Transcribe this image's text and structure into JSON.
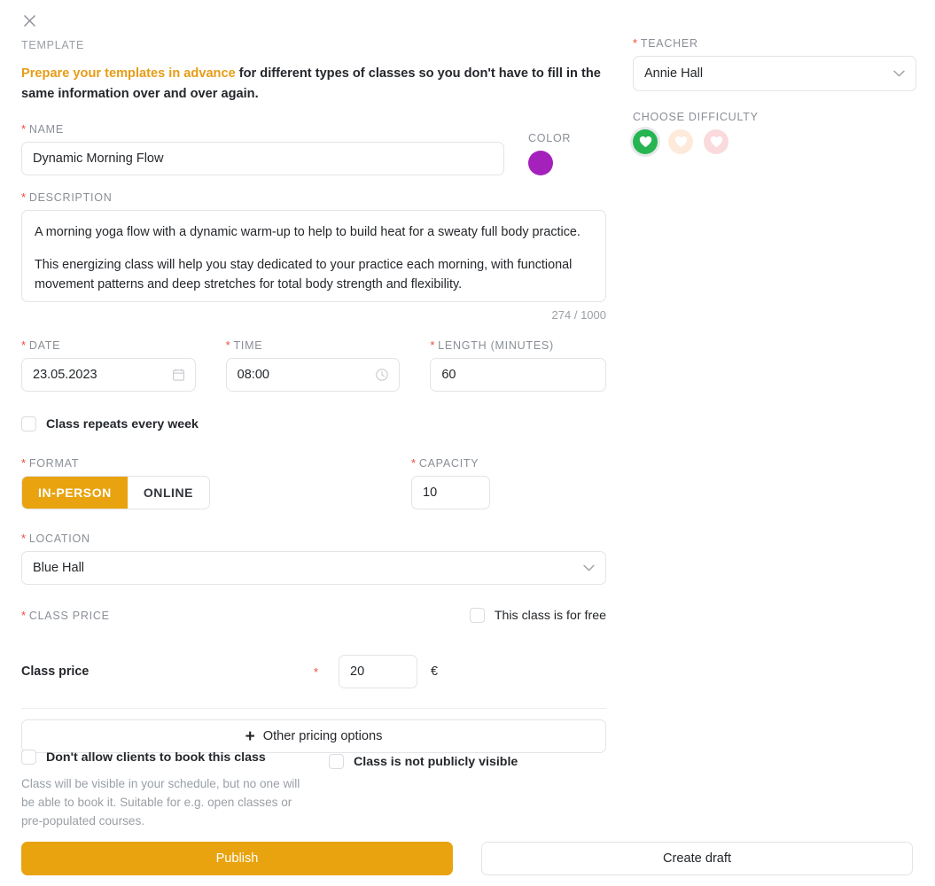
{
  "window": {
    "close_icon": "close-icon"
  },
  "template": {
    "section_label": "TEMPLATE",
    "intro_highlight": "Prepare your templates in advance",
    "intro_rest": " for different types of classes so you don't have to fill in the same information over and over again."
  },
  "name": {
    "label": "NAME",
    "value": "Dynamic Morning Flow"
  },
  "color": {
    "label": "COLOR",
    "value": "#a521bb"
  },
  "description": {
    "label": "DESCRIPTION",
    "paragraph1": "A morning yoga flow with a dynamic warm-up to help to build heat for a sweaty full body practice.",
    "paragraph2": "This energizing class will help you stay dedicated to your practice each morning, with functional movement patterns and deep stretches for total body strength and flexibility.",
    "counter": "274 / 1000"
  },
  "date": {
    "label": "DATE",
    "value": "23.05.2023",
    "icon": "calendar-icon"
  },
  "time": {
    "label": "TIME",
    "value": "08:00",
    "icon": "clock-icon"
  },
  "length": {
    "label": "LENGTH (MINUTES)",
    "value": "60"
  },
  "repeat": {
    "label": "Class repeats every week",
    "checked": false
  },
  "format": {
    "label": "FORMAT",
    "options": [
      "IN-PERSON",
      "ONLINE"
    ],
    "selected": "IN-PERSON"
  },
  "capacity": {
    "label": "CAPACITY",
    "value": "10"
  },
  "location": {
    "label": "LOCATION",
    "value": "Blue Hall",
    "icon": "chevron-down-icon"
  },
  "price": {
    "label": "CLASS PRICE",
    "free_label": "This class is for free",
    "free_checked": false,
    "row_name": "Class price",
    "row_required": "*",
    "value": "20",
    "currency": "€",
    "other_options": "Other pricing options",
    "plus_icon": "+"
  },
  "booking": {
    "no_book_label": "Don't allow clients to book this class",
    "no_book_checked": false,
    "help_text": "Class will be visible in your schedule, but no one will be able to book it. Suitable for e.g. open classes or pre-populated courses.",
    "not_public_label": "Class is not publicly visible",
    "not_public_checked": false
  },
  "teacher": {
    "label": "TEACHER",
    "value": "Annie Hall",
    "icon": "chevron-down-icon"
  },
  "difficulty": {
    "label": "CHOOSE DIFFICULTY",
    "levels": [
      {
        "name": "beginner",
        "color": "#26b551",
        "selected": true
      },
      {
        "name": "intermediate",
        "color": "#fdeadb",
        "selected": false
      },
      {
        "name": "advanced",
        "color": "#fadadd",
        "selected": false
      }
    ]
  },
  "footer": {
    "publish_label": "Publish",
    "draft_label": "Create draft",
    "publish_color": "#e8a30e"
  }
}
